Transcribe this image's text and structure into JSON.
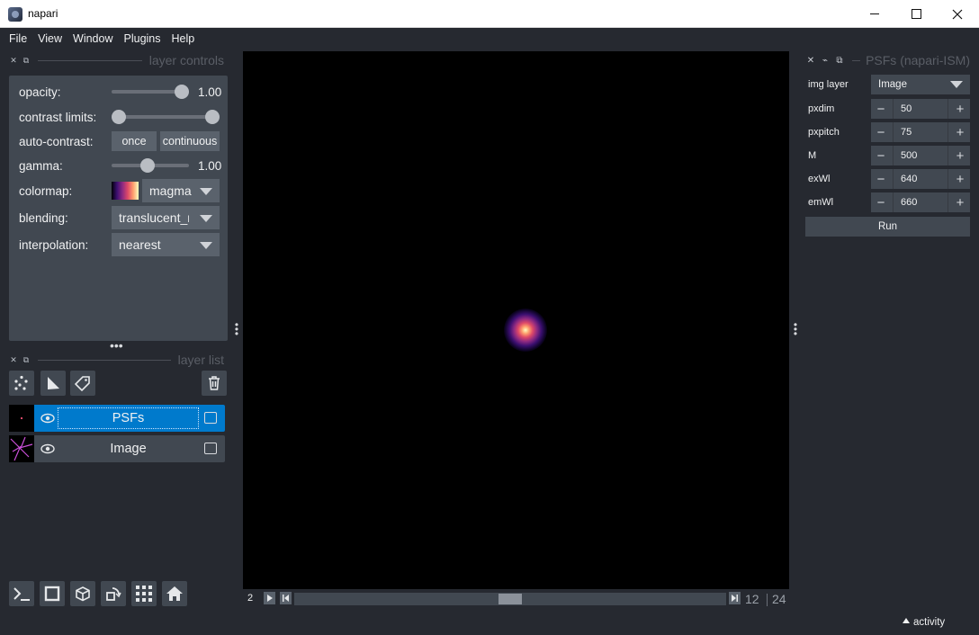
{
  "window": {
    "title": "napari"
  },
  "menu": [
    "File",
    "View",
    "Window",
    "Plugins",
    "Help"
  ],
  "layer_controls": {
    "header": "layer controls",
    "opacity": {
      "label": "opacity:",
      "value": "1.00"
    },
    "contrast_limits": {
      "label": "contrast limits:"
    },
    "auto_contrast": {
      "label": "auto-contrast:",
      "once": "once",
      "continuous": "continuous"
    },
    "gamma": {
      "label": "gamma:",
      "value": "1.00"
    },
    "colormap": {
      "label": "colormap:",
      "value": "magma"
    },
    "blending": {
      "label": "blending:",
      "value": "translucent_no_depth"
    },
    "interpolation": {
      "label": "interpolation:",
      "value": "nearest"
    }
  },
  "layer_list": {
    "header": "layer list",
    "layers": [
      {
        "name": "PSFs",
        "selected": true
      },
      {
        "name": "Image",
        "selected": false
      }
    ]
  },
  "dims": {
    "axis": "2",
    "current": "12",
    "max": "24",
    "slider_fraction": 0.5
  },
  "widget": {
    "title": "PSFs (napari-ISM)",
    "img_layer": {
      "label": "img layer",
      "value": "Image"
    },
    "params": [
      {
        "label": "pxdim",
        "value": "50"
      },
      {
        "label": "pxpitch",
        "value": "75"
      },
      {
        "label": "M",
        "value": "500"
      },
      {
        "label": "exWl",
        "value": "640"
      },
      {
        "label": "emWl",
        "value": "660"
      }
    ],
    "run": "Run"
  },
  "status": {
    "activity": "activity"
  },
  "colors": {
    "background": "#262930",
    "panel": "#414851",
    "selected": "#007acc",
    "control": "#5a626c"
  }
}
